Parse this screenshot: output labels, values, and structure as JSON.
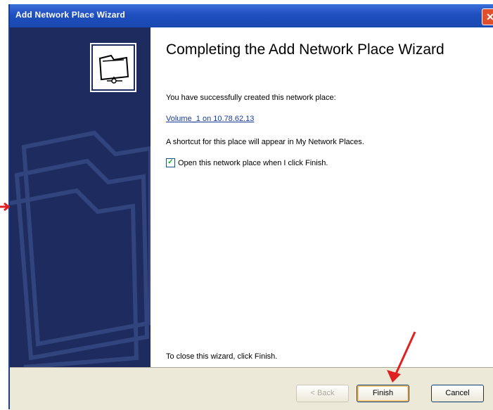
{
  "window": {
    "title": "Add Network Place Wizard"
  },
  "heading": "Completing the Add Network Place Wizard",
  "messages": {
    "success": "You have successfully created this network place:",
    "place_link": "Volume_1 on 10.78.62.13",
    "shortcut": "A shortcut for this place will appear in My Network Places.",
    "checkbox_label": "Open this network place when I click Finish.",
    "close_hint": "To close this wizard, click Finish."
  },
  "checkbox_checked": true,
  "buttons": {
    "back": "< Back",
    "finish": "Finish",
    "cancel": "Cancel"
  },
  "colors": {
    "title_bar": "#1f4fbf",
    "side_panel": "#1d2b5f",
    "annotation_arrow": "#e02020"
  }
}
